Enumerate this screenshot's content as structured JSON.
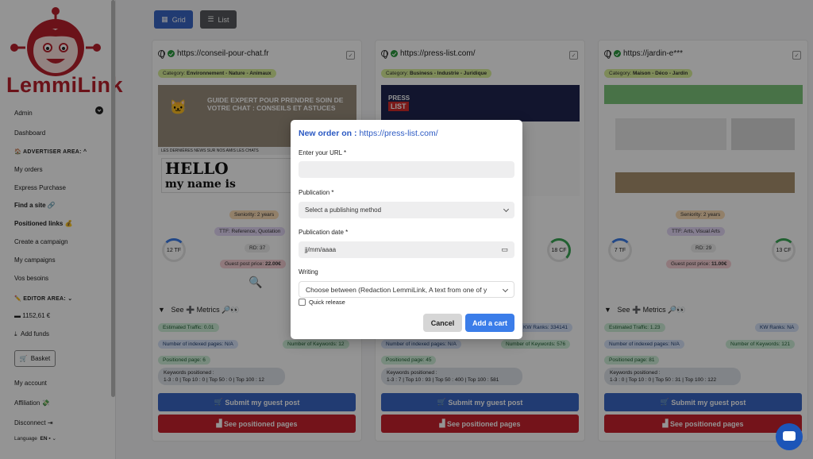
{
  "brand": {
    "name": "LemmiLink",
    "accent": "#b9202b"
  },
  "sidebar": {
    "items": [
      {
        "label": "Admin"
      },
      {
        "label": "Dashboard"
      },
      {
        "label": "ADVERTISER AREA:"
      },
      {
        "label": "My orders"
      },
      {
        "label": "Express Purchase"
      },
      {
        "label": "Find a site"
      },
      {
        "label": "Positioned links"
      },
      {
        "label": "Create a campaign"
      },
      {
        "label": "My campaigns"
      },
      {
        "label": "Vos besoins"
      },
      {
        "label": "EDITOR AREA:"
      },
      {
        "label": "1152,61 €"
      },
      {
        "label": "Add funds"
      },
      {
        "label": "Basket"
      },
      {
        "label": "My account"
      },
      {
        "label": "Affiliation"
      },
      {
        "label": "Disconnect"
      }
    ],
    "language": "Language",
    "language_value": "EN"
  },
  "view_toggle": {
    "grid": "Grid",
    "list": "List"
  },
  "cards": [
    {
      "url": "https://conseil-pour-chat.fr",
      "category_prefix": "Category:",
      "category": "Environnement - Nature - Animaux",
      "seniority": "Seniority: 2 years",
      "ttf": "TTF: Reference, Quotation",
      "rd": "RD: 37",
      "tf": "12 TF",
      "cf": "",
      "price_prefix": "Guest post price:",
      "price": "22.00€",
      "metrics": "See ➕ Metrics 🔎👀",
      "traffic": "Estimated Traffic: 0.01",
      "kw_ranks": "",
      "indexed": "Number of indexed pages: N/A",
      "keywords": "Number of Keywords: 12",
      "positioned": "Positioned page: 6",
      "kw_pos_label": "Keywords positioned :",
      "kw_pos": "1-3 : 0 | Top 10 : 0 | Top 50 : 0 | Top 100 : 12",
      "submit": "Submit my guest post",
      "see_pages": "See positioned pages",
      "thumb_headline": "GUIDE EXPERT POUR PRENDRE SOIN DE VOTRE CHAT : CONSEILS ET ASTUCES",
      "thumb_news": "LES DERNIÈRES NEWS SUR NOS AMIS LES CHATS",
      "thumb_hello": "HELLO",
      "thumb_name": "my name is"
    },
    {
      "url": "https://press-list.com/",
      "category_prefix": "Category:",
      "category": "Business - Industrie - Juridique",
      "seniority": "",
      "ttf": "",
      "rd": "",
      "tf": "",
      "cf": "18 CF",
      "price_prefix": "",
      "price": "",
      "metrics": "",
      "traffic": "",
      "kw_ranks": "KW Ranks: 334141",
      "indexed": "Number of indexed pages: N/A",
      "keywords": "Number of Keywords: 576",
      "positioned": "Positioned page: 45",
      "kw_pos_label": "Keywords positioned :",
      "kw_pos": "1-3 : 7 | Top 10 : 93 | Top 50 : 400 | Top 100 : 581",
      "submit": "Submit my guest post",
      "see_pages": "See positioned pages",
      "thumb_logo1": "PRESS",
      "thumb_logo2": "LIST"
    },
    {
      "url": "https://jardin-e***",
      "category_prefix": "Category:",
      "category": "Maison - Déco - Jardin",
      "seniority": "Seniority: 2 years",
      "ttf": "TTF: Arts, Visual Arts",
      "rd": "RD: 29",
      "tf": "7 TF",
      "cf": "13 CF",
      "price_prefix": "Guest post price:",
      "price": "11.00€",
      "metrics": "See ➕ Metrics 🔎👀",
      "traffic": "Estimated Traffic: 1.23",
      "kw_ranks": "KW Ranks: NA",
      "indexed": "Number of indexed pages: N/A",
      "keywords": "Number of Keywords: 121",
      "positioned": "Positioned page: 81",
      "kw_pos_label": "Keywords positioned :",
      "kw_pos": "1-3 : 0 | Top 10 : 0 | Top 50 : 31 | Top 100 : 122",
      "submit": "Submit my guest post",
      "see_pages": "See positioned pages"
    }
  ],
  "modal": {
    "title": "New order on :",
    "title_url": "https://press-list.com/",
    "url_label": "Enter your URL *",
    "url_value": "",
    "publication_label": "Publication *",
    "publication_value": "Select a publishing method",
    "date_label": "Publication date *",
    "date_placeholder": "jj/mm/aaaa",
    "writing_label": "Writing",
    "writing_value": "Choose between (Redaction LemmiLink, A text from one of y",
    "quick_release": "Quick release",
    "cancel": "Cancel",
    "add": "Add a cart"
  }
}
